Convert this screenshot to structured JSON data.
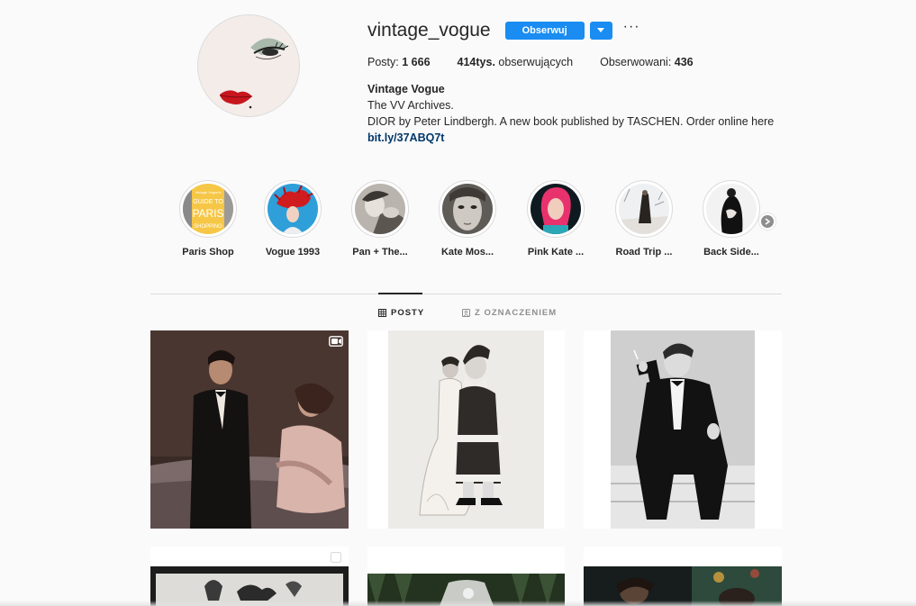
{
  "profile": {
    "username": "vintage_vogue",
    "follow_label": "Obserwuj",
    "more_label": "···",
    "stats": {
      "posts_label": "Posty:",
      "posts_value": "1 666",
      "followers_value": "414tys.",
      "followers_label": "obserwujących",
      "following_label": "Obserwowani:",
      "following_value": "436"
    },
    "bio": {
      "name": "Vintage Vogue",
      "line1": "The VV Archives.",
      "line2": "DIOR by Peter Lindbergh. A new book published by TASCHEN. Order online here",
      "link": "bit.ly/37ABQ7t"
    }
  },
  "highlights": [
    {
      "label": "Paris Shop",
      "icon": "paris-guide-cover"
    },
    {
      "label": "Vogue 1993",
      "icon": "red-feather-hat"
    },
    {
      "label": "Pan + The...",
      "icon": "bw-portrait"
    },
    {
      "label": "Kate Mos...",
      "icon": "face-portrait"
    },
    {
      "label": "Pink Kate ...",
      "icon": "pink-hair-portrait"
    },
    {
      "label": "Road Trip ...",
      "icon": "figure-on-road"
    },
    {
      "label": "Back Side...",
      "icon": "bw-back-pose"
    }
  ],
  "paris_cover_text": [
    "Vintage Vogue's",
    "GUIDE TO",
    "PARIS",
    "SHOPPING"
  ],
  "tabs": [
    {
      "label": "POSTY",
      "icon": "grid-icon",
      "active": true
    },
    {
      "label": "Z OZNACZENIEM",
      "icon": "tagged-icon",
      "active": false
    }
  ],
  "posts": [
    {
      "type": "video",
      "icon": "igtv-icon"
    },
    {
      "type": "photo"
    },
    {
      "type": "photo"
    },
    {
      "type": "carousel",
      "icon": "multiple-icon"
    },
    {
      "type": "photo"
    },
    {
      "type": "photo"
    }
  ],
  "colors": {
    "accent": "#1a8cf2",
    "link": "#00376b",
    "text": "#262626",
    "muted": "#8e8e8e",
    "border": "#dbdbdb",
    "background": "#fafafa"
  }
}
